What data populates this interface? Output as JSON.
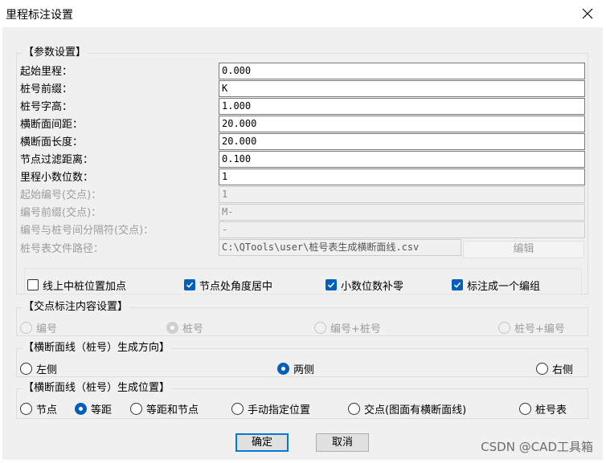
{
  "window": {
    "title": "里程标注设置"
  },
  "params": {
    "group_title": "【参数设置】",
    "fields": [
      {
        "label": "起始里程：",
        "value": "0.000"
      },
      {
        "label": "桩号前缀：",
        "value": "K"
      },
      {
        "label": "桩号字高：",
        "value": "1.000"
      },
      {
        "label": "横断面间距：",
        "value": "20.000"
      },
      {
        "label": "横断面长度：",
        "value": "20.000"
      },
      {
        "label": "节点过滤距离：",
        "value": "0.100"
      },
      {
        "label": "里程小数位数：",
        "value": "1"
      },
      {
        "label": "起始编号(交点)：",
        "value": "1"
      },
      {
        "label": "编号前缀(交点)：",
        "value": "M-"
      },
      {
        "label": "编号与桩号间分隔符(交点)：",
        "value": "-"
      },
      {
        "label": "桩号表文件路径：",
        "value": "C:\\QTools\\user\\桩号表生成横断面线.csv"
      }
    ],
    "edit_button": "编辑",
    "checkboxes": [
      {
        "label": "线上中桩位置加点",
        "checked": false
      },
      {
        "label": "节点处角度居中",
        "checked": true
      },
      {
        "label": "小数位数补零",
        "checked": true
      },
      {
        "label": "标注成一个编组",
        "checked": true
      }
    ]
  },
  "intersection": {
    "group_title": "【交点标注内容设置】",
    "options": [
      "编号",
      "桩号",
      "编号+桩号",
      "桩号+编号"
    ],
    "selected": "桩号"
  },
  "direction": {
    "group_title": "【横断面线（桩号）生成方向】",
    "options": [
      "左侧",
      "两侧",
      "右侧"
    ],
    "selected": "两侧"
  },
  "position": {
    "group_title": "【横断面线（桩号）生成位置】",
    "options": [
      "节点",
      "等距",
      "等距和节点",
      "手动指定位置",
      "交点(图面有横断面线)",
      "桩号表"
    ],
    "selected": "等距"
  },
  "footer": {
    "ok": "确定",
    "cancel": "取消"
  },
  "watermark": "CSDN @CAD工具箱",
  "colors": {
    "accent": "#005fb8",
    "dialog_bg": "#f0f0f0"
  }
}
